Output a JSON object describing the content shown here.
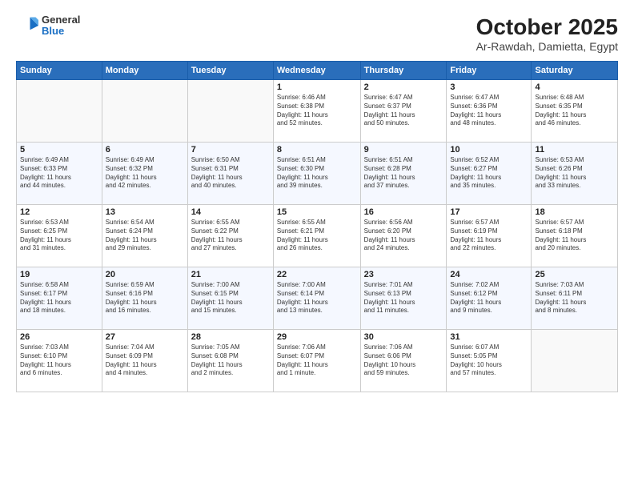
{
  "header": {
    "logo": {
      "general": "General",
      "blue": "Blue"
    },
    "title": "October 2025",
    "location": "Ar-Rawdah, Damietta, Egypt"
  },
  "weekdays": [
    "Sunday",
    "Monday",
    "Tuesday",
    "Wednesday",
    "Thursday",
    "Friday",
    "Saturday"
  ],
  "weeks": [
    [
      {
        "day": "",
        "info": ""
      },
      {
        "day": "",
        "info": ""
      },
      {
        "day": "",
        "info": ""
      },
      {
        "day": "1",
        "info": "Sunrise: 6:46 AM\nSunset: 6:38 PM\nDaylight: 11 hours\nand 52 minutes."
      },
      {
        "day": "2",
        "info": "Sunrise: 6:47 AM\nSunset: 6:37 PM\nDaylight: 11 hours\nand 50 minutes."
      },
      {
        "day": "3",
        "info": "Sunrise: 6:47 AM\nSunset: 6:36 PM\nDaylight: 11 hours\nand 48 minutes."
      },
      {
        "day": "4",
        "info": "Sunrise: 6:48 AM\nSunset: 6:35 PM\nDaylight: 11 hours\nand 46 minutes."
      }
    ],
    [
      {
        "day": "5",
        "info": "Sunrise: 6:49 AM\nSunset: 6:33 PM\nDaylight: 11 hours\nand 44 minutes."
      },
      {
        "day": "6",
        "info": "Sunrise: 6:49 AM\nSunset: 6:32 PM\nDaylight: 11 hours\nand 42 minutes."
      },
      {
        "day": "7",
        "info": "Sunrise: 6:50 AM\nSunset: 6:31 PM\nDaylight: 11 hours\nand 40 minutes."
      },
      {
        "day": "8",
        "info": "Sunrise: 6:51 AM\nSunset: 6:30 PM\nDaylight: 11 hours\nand 39 minutes."
      },
      {
        "day": "9",
        "info": "Sunrise: 6:51 AM\nSunset: 6:28 PM\nDaylight: 11 hours\nand 37 minutes."
      },
      {
        "day": "10",
        "info": "Sunrise: 6:52 AM\nSunset: 6:27 PM\nDaylight: 11 hours\nand 35 minutes."
      },
      {
        "day": "11",
        "info": "Sunrise: 6:53 AM\nSunset: 6:26 PM\nDaylight: 11 hours\nand 33 minutes."
      }
    ],
    [
      {
        "day": "12",
        "info": "Sunrise: 6:53 AM\nSunset: 6:25 PM\nDaylight: 11 hours\nand 31 minutes."
      },
      {
        "day": "13",
        "info": "Sunrise: 6:54 AM\nSunset: 6:24 PM\nDaylight: 11 hours\nand 29 minutes."
      },
      {
        "day": "14",
        "info": "Sunrise: 6:55 AM\nSunset: 6:22 PM\nDaylight: 11 hours\nand 27 minutes."
      },
      {
        "day": "15",
        "info": "Sunrise: 6:55 AM\nSunset: 6:21 PM\nDaylight: 11 hours\nand 26 minutes."
      },
      {
        "day": "16",
        "info": "Sunrise: 6:56 AM\nSunset: 6:20 PM\nDaylight: 11 hours\nand 24 minutes."
      },
      {
        "day": "17",
        "info": "Sunrise: 6:57 AM\nSunset: 6:19 PM\nDaylight: 11 hours\nand 22 minutes."
      },
      {
        "day": "18",
        "info": "Sunrise: 6:57 AM\nSunset: 6:18 PM\nDaylight: 11 hours\nand 20 minutes."
      }
    ],
    [
      {
        "day": "19",
        "info": "Sunrise: 6:58 AM\nSunset: 6:17 PM\nDaylight: 11 hours\nand 18 minutes."
      },
      {
        "day": "20",
        "info": "Sunrise: 6:59 AM\nSunset: 6:16 PM\nDaylight: 11 hours\nand 16 minutes."
      },
      {
        "day": "21",
        "info": "Sunrise: 7:00 AM\nSunset: 6:15 PM\nDaylight: 11 hours\nand 15 minutes."
      },
      {
        "day": "22",
        "info": "Sunrise: 7:00 AM\nSunset: 6:14 PM\nDaylight: 11 hours\nand 13 minutes."
      },
      {
        "day": "23",
        "info": "Sunrise: 7:01 AM\nSunset: 6:13 PM\nDaylight: 11 hours\nand 11 minutes."
      },
      {
        "day": "24",
        "info": "Sunrise: 7:02 AM\nSunset: 6:12 PM\nDaylight: 11 hours\nand 9 minutes."
      },
      {
        "day": "25",
        "info": "Sunrise: 7:03 AM\nSunset: 6:11 PM\nDaylight: 11 hours\nand 8 minutes."
      }
    ],
    [
      {
        "day": "26",
        "info": "Sunrise: 7:03 AM\nSunset: 6:10 PM\nDaylight: 11 hours\nand 6 minutes."
      },
      {
        "day": "27",
        "info": "Sunrise: 7:04 AM\nSunset: 6:09 PM\nDaylight: 11 hours\nand 4 minutes."
      },
      {
        "day": "28",
        "info": "Sunrise: 7:05 AM\nSunset: 6:08 PM\nDaylight: 11 hours\nand 2 minutes."
      },
      {
        "day": "29",
        "info": "Sunrise: 7:06 AM\nSunset: 6:07 PM\nDaylight: 11 hours\nand 1 minute."
      },
      {
        "day": "30",
        "info": "Sunrise: 7:06 AM\nSunset: 6:06 PM\nDaylight: 10 hours\nand 59 minutes."
      },
      {
        "day": "31",
        "info": "Sunrise: 6:07 AM\nSunset: 5:05 PM\nDaylight: 10 hours\nand 57 minutes."
      },
      {
        "day": "",
        "info": ""
      }
    ]
  ]
}
